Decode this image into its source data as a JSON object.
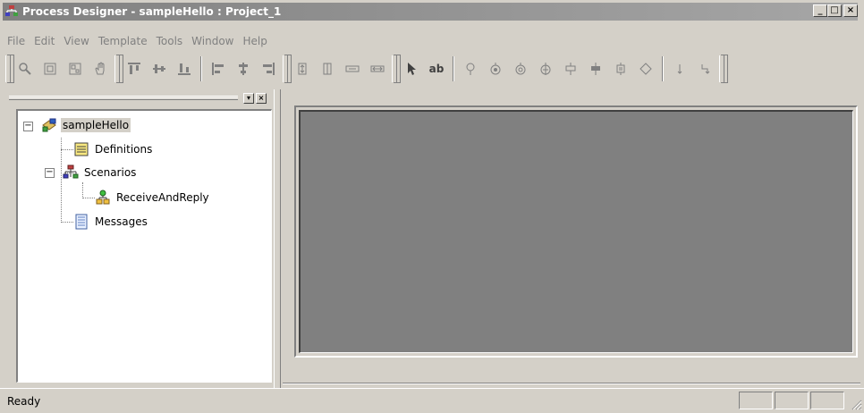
{
  "window": {
    "title": "Process Designer - sampleHello : Project_1",
    "controls": {
      "minimize": "_",
      "maximize": "□",
      "close": "×"
    }
  },
  "menu": [
    "File",
    "Edit",
    "View",
    "Template",
    "Tools",
    "Window",
    "Help"
  ],
  "toolbar": {
    "text_tool_label": "ab",
    "icons": [
      "zoom-icon",
      "fit-icon",
      "zoom-area-icon",
      "pan-hand-icon",
      "align-top-icon",
      "align-middle-icon",
      "align-bottom-icon",
      "align-left-icon",
      "align-center-icon",
      "align-right-icon",
      "same-height-icon",
      "same-height-alt-icon",
      "same-width-icon",
      "same-width-alt-icon",
      "pointer-icon",
      "text-icon",
      "start-node-icon",
      "receive-node-icon",
      "reply-node-icon",
      "invoke-node-icon",
      "fork-node-icon",
      "join-node-icon",
      "assign-node-icon",
      "decision-node-icon",
      "arrow-down-icon",
      "connector-icon"
    ]
  },
  "tree": {
    "root": {
      "label": "sampleHello",
      "icon": "project-icon",
      "expanded": true
    },
    "items": [
      {
        "label": "Definitions",
        "icon": "definitions-icon"
      },
      {
        "label": "Scenarios",
        "icon": "scenarios-icon",
        "expanded": true,
        "children": [
          {
            "label": "ReceiveAndReply",
            "icon": "scenario-flow-icon"
          }
        ]
      },
      {
        "label": "Messages",
        "icon": "messages-icon"
      }
    ]
  },
  "panel_controls": {
    "dock": "▾",
    "close": "×"
  },
  "status": {
    "text": "Ready"
  },
  "colors": {
    "titlebar": "#808080",
    "canvas": "#808080",
    "chrome": "#d4d0c8"
  }
}
